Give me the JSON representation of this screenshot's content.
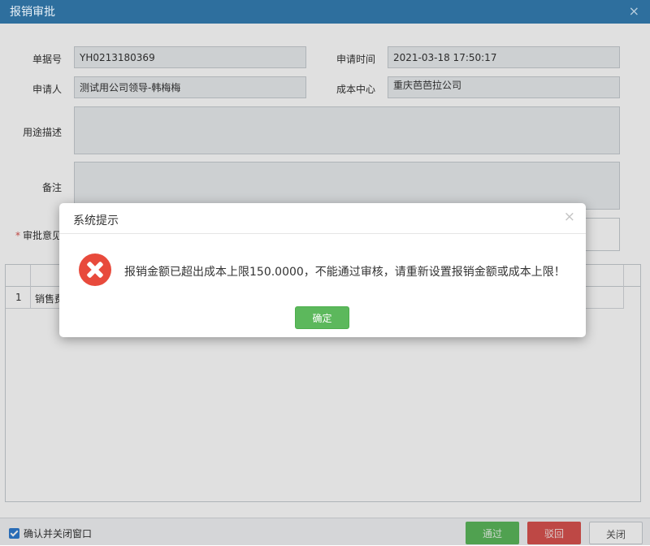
{
  "window": {
    "title": "报销审批",
    "close_glyph": "×"
  },
  "form": {
    "doc_no": {
      "label": "单据号",
      "value": "YH0213180369"
    },
    "apply_time": {
      "label": "申请时间",
      "value": "2021-03-18 17:50:17"
    },
    "applicant": {
      "label": "申请人",
      "value": "测试用公司领导-韩梅梅"
    },
    "cost_center": {
      "label": "成本中心",
      "value": "重庆芭芭拉公司"
    },
    "purpose": {
      "label": "用途描述",
      "value": ""
    },
    "remark": {
      "label": "备注",
      "value": ""
    },
    "approval_opinion": {
      "label": "审批意见",
      "required_mark": "*"
    }
  },
  "grid": {
    "rows": [
      {
        "index": "1",
        "category": "销售费"
      }
    ]
  },
  "footer": {
    "confirm_close_label": "确认并关闭窗口",
    "confirm_close_checked": true,
    "pass_label": "通过",
    "reject_label": "驳回",
    "close_label": "关闭"
  },
  "dialog": {
    "title": "系统提示",
    "close_glyph": "×",
    "icon": "error-icon",
    "message": "报销金额已超出成本上限150.0000，不能通过审核，请重新设置报销金额或成本上限！",
    "ok_label": "确定"
  },
  "colors": {
    "titlebar": "#2e6f9e",
    "pass": "#5cb85c",
    "reject": "#d9534f",
    "error": "#e84a3c"
  }
}
